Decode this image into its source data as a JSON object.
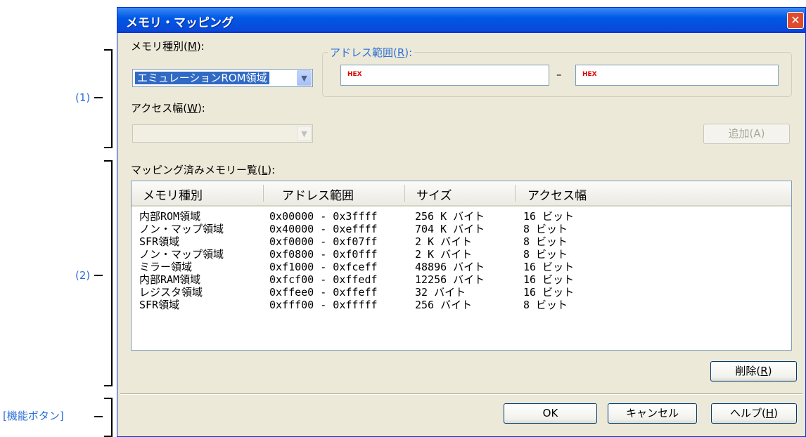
{
  "annotations": {
    "section1": "(1)",
    "section2": "(2)",
    "function_buttons": "[機能ボタン]"
  },
  "dialog": {
    "title": "メモリ・マッピング",
    "close_icon": "close-x"
  },
  "memory_type": {
    "label": "メモリ種別(",
    "mnemonic": "M",
    "label_end": "):",
    "selected": "エミュレーションROM領域"
  },
  "access_width": {
    "label": "アクセス幅(",
    "mnemonic": "W",
    "label_end": "):",
    "selected": ""
  },
  "address_range": {
    "label": "アドレス範囲(",
    "mnemonic": "R",
    "label_end": "):",
    "start_tag": "HEX",
    "end_tag": "HEX",
    "start_value": "",
    "end_value": "",
    "separator": "–"
  },
  "add_button": "追加(A)",
  "mapped_list": {
    "label": "マッピング済みメモリー覧(",
    "mnemonic": "L",
    "label_end": "):",
    "columns": [
      "メモリ種別",
      "アドレス範囲",
      "サイズ",
      "アクセス幅"
    ],
    "rows": [
      [
        "内部ROM領域",
        "0x00000 - 0x3ffff",
        "256 K バイト",
        "16 ビット"
      ],
      [
        "ノン・マップ領域",
        "0x40000 - 0xeffff",
        "704 K バイト",
        "8 ビット"
      ],
      [
        "SFR領域",
        "0xf0000 - 0xf07ff",
        "2 K バイト",
        "8 ビット"
      ],
      [
        "ノン・マップ領域",
        "0xf0800 - 0xf0fff",
        "2 K バイト",
        "8 ビット"
      ],
      [
        "ミラー領域",
        "0xf1000 - 0xfceff",
        "48896 バイト",
        "16 ビット"
      ],
      [
        "内部RAM領域",
        "0xfcf00 - 0xffedf",
        "12256 バイト",
        "16 ビット"
      ],
      [
        "レジスタ領域",
        "0xffee0 - 0xffeff",
        "32 バイト",
        "16 ビット"
      ],
      [
        "SFR領域",
        "0xfff00 - 0xfffff",
        "256 バイト",
        "8 ビット"
      ]
    ]
  },
  "delete_button": {
    "label": "削除(",
    "mnemonic": "R",
    "label_end": ")"
  },
  "buttons": {
    "ok": "OK",
    "cancel": "キャンセル",
    "help_label": "ヘルプ(",
    "help_mnemonic": "H",
    "help_end": ")"
  }
}
